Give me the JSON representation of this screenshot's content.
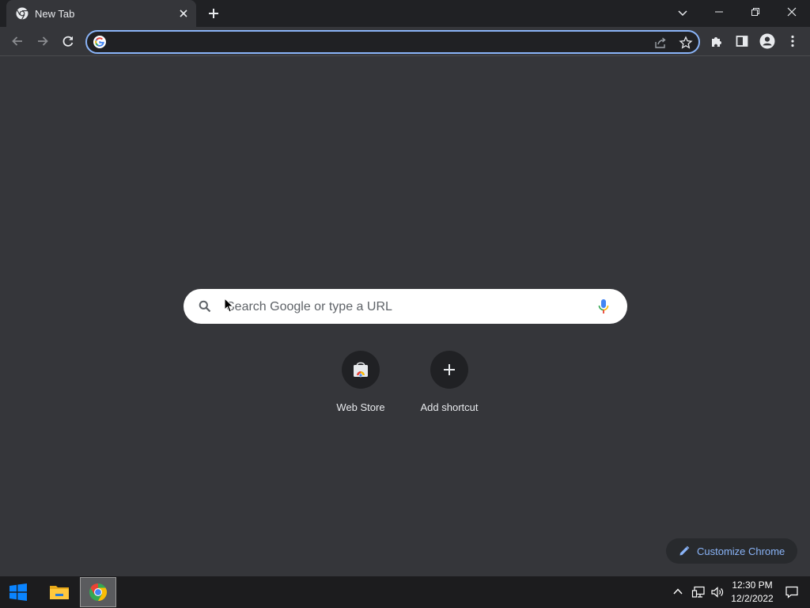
{
  "browser": {
    "tab": {
      "title": "New Tab"
    },
    "omnibox": {
      "value": "",
      "placeholder": ""
    }
  },
  "ntp": {
    "search": {
      "placeholder": "Search Google or type a URL"
    },
    "shortcuts": [
      {
        "label": "Web Store",
        "icon": "webstore-icon"
      },
      {
        "label": "Add shortcut",
        "icon": "plus-icon"
      }
    ],
    "customize_label": "Customize Chrome"
  },
  "taskbar": {
    "time": "12:30 PM",
    "date": "12/2/2022"
  },
  "colors": {
    "page_background": "#35363a",
    "titlebar": "#202124",
    "accent": "#8ab4f8",
    "taskbar": "#1c1c1e"
  }
}
